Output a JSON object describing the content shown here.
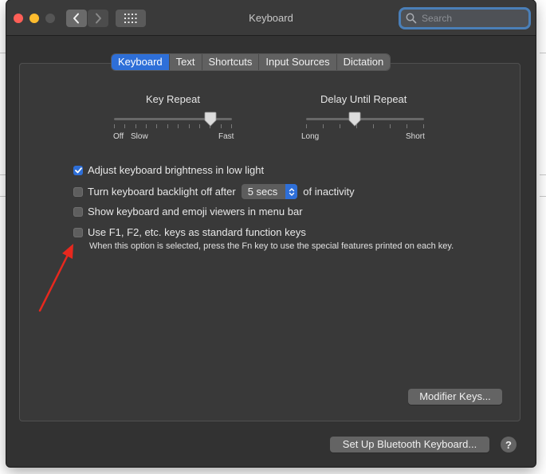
{
  "window": {
    "title": "Keyboard"
  },
  "search": {
    "placeholder": "Search"
  },
  "tabs": [
    {
      "label": "Keyboard",
      "active": true
    },
    {
      "label": "Text",
      "active": false
    },
    {
      "label": "Shortcuts",
      "active": false
    },
    {
      "label": "Input Sources",
      "active": false
    },
    {
      "label": "Dictation",
      "active": false
    }
  ],
  "key_repeat": {
    "title": "Key Repeat",
    "labels": {
      "off": "Off",
      "slow": "Slow",
      "fast": "Fast"
    },
    "value_fraction": 0.82
  },
  "delay_until_repeat": {
    "title": "Delay Until Repeat",
    "labels": {
      "long": "Long",
      "short": "Short"
    },
    "value_fraction": 0.41
  },
  "options": {
    "brightness": {
      "label": "Adjust keyboard brightness in low light",
      "checked": true
    },
    "backlight": {
      "label": "Turn keyboard backlight off after",
      "checked": false,
      "popup_value": "5 secs",
      "suffix": "of inactivity"
    },
    "viewers": {
      "label": "Show keyboard and emoji viewers in menu bar",
      "checked": false
    },
    "fn_keys": {
      "label": "Use F1, F2, etc. keys as standard function keys",
      "checked": false,
      "note": "When this option is selected, press the Fn key to use the special features printed on each key."
    }
  },
  "buttons": {
    "modifier": "Modifier Keys...",
    "bluetooth": "Set Up Bluetooth Keyboard...",
    "help": "?"
  },
  "colors": {
    "accent": "#2e6fd8",
    "window_bg": "#323232",
    "annotation_arrow": "#e8281e"
  }
}
